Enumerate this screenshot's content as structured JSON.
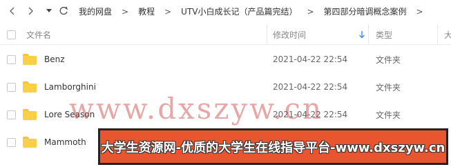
{
  "breadcrumb": [
    "我的网盘",
    "教程",
    "UTV小白成长记（产品篇完结）",
    "第四部分暗调概念案例"
  ],
  "columns": {
    "name": "文件名",
    "modified": "修改时间",
    "type": "类型",
    "size": "大"
  },
  "rows": [
    {
      "name": "Benz",
      "modified": "2021-04-22 22:54",
      "type": "文件夹"
    },
    {
      "name": "Lamborghini",
      "modified": "2021-04-22 22:54",
      "type": "文件夹"
    },
    {
      "name": "Lore Season",
      "modified": "2021-04-22 22:54",
      "type": "文件夹"
    },
    {
      "name": "Mammoth",
      "modified": "",
      "type": ""
    }
  ],
  "watermark": "www.dxszyw.cn",
  "banner": "大学生资源网-优质的大学生在线指导平台-www.dxszyw.cn",
  "colors": {
    "folder": "#fbcf47",
    "sort_arrow": "#3b8cf5",
    "banner_bg": "#e8552e"
  },
  "icons": [
    "chevron-left-icon",
    "chevron-right-icon",
    "caret-down-icon",
    "refresh-icon",
    "sort-down-icon",
    "folder-icon"
  ]
}
